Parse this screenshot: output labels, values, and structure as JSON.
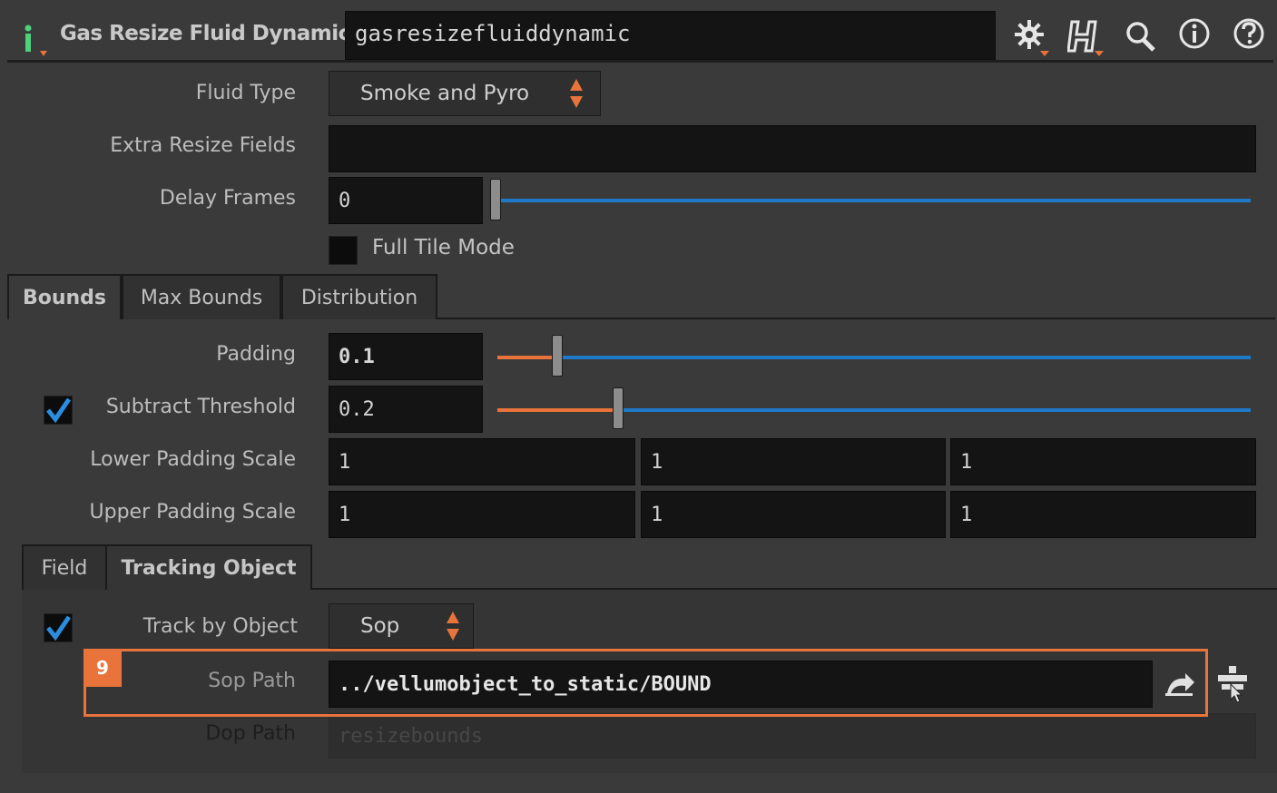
{
  "header": {
    "node_title": "Gas Resize Fluid Dynamic",
    "node_name": "gasresizefluiddynamic",
    "icons": [
      "gear-icon",
      "houdini-help-icon",
      "search-icon",
      "info-icon",
      "help-icon"
    ]
  },
  "params": {
    "fluid_type": {
      "label": "Fluid Type",
      "value": "Smoke and Pyro"
    },
    "extra_resize_fields": {
      "label": "Extra Resize Fields",
      "value": ""
    },
    "delay_frames": {
      "label": "Delay Frames",
      "value": "0",
      "slider_fraction": 0.0
    },
    "full_tile_mode": {
      "label": "Full Tile Mode",
      "checked": false
    }
  },
  "tabs": {
    "main": [
      {
        "label": "Bounds",
        "active": true
      },
      {
        "label": "Max Bounds",
        "active": false
      },
      {
        "label": "Distribution",
        "active": false
      }
    ],
    "sub": [
      {
        "label": "Field",
        "active": false
      },
      {
        "label": "Tracking Object",
        "active": true
      }
    ]
  },
  "bounds": {
    "padding": {
      "label": "Padding",
      "value": "0.1",
      "slider_fraction": 0.1
    },
    "subtract_threshold": {
      "label": "Subtract Threshold",
      "value": "0.2",
      "checked": true,
      "slider_fraction": 0.2
    },
    "lower_padding_scale": {
      "label": "Lower Padding Scale",
      "values": [
        "1",
        "1",
        "1"
      ]
    },
    "upper_padding_scale": {
      "label": "Upper Padding Scale",
      "values": [
        "1",
        "1",
        "1"
      ]
    }
  },
  "tracking": {
    "track_by_object": {
      "label": "Track by Object",
      "checked": true,
      "value": "Sop"
    },
    "sop_path": {
      "label": "Sop Path",
      "value": "../vellumobject_to_static/BOUND"
    },
    "dop_path": {
      "label": "Dop Path",
      "placeholder": "resizebounds"
    }
  },
  "annotation": {
    "badge": "9"
  },
  "colors": {
    "accent_orange": "#e8743b",
    "slider_blue": "#1e7ac8",
    "check_blue": "#2a8de0"
  }
}
